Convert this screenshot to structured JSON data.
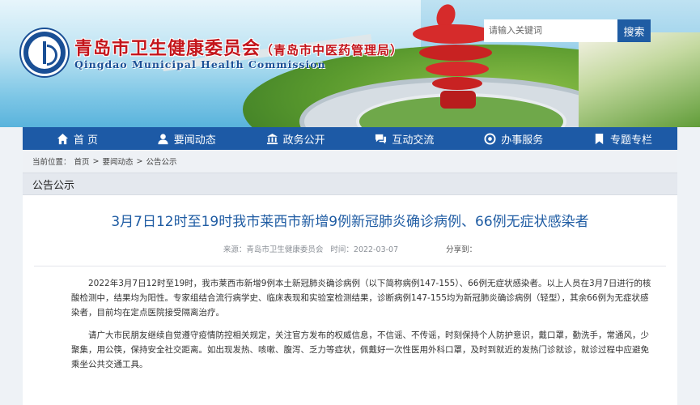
{
  "header": {
    "title_main": "青岛市卫生健康委员会",
    "title_sub": "（青岛市中医药管理局）",
    "title_en": "Qingdao Municipal Health Commission",
    "logo_icon": "health-commission-emblem"
  },
  "search": {
    "placeholder": "请输入关键词",
    "button_label": "搜索"
  },
  "nav": {
    "items": [
      {
        "label": "首 页",
        "icon": "home-icon"
      },
      {
        "label": "要闻动态",
        "icon": "user-icon"
      },
      {
        "label": "政务公开",
        "icon": "bank-icon"
      },
      {
        "label": "互动交流",
        "icon": "chat-icon"
      },
      {
        "label": "办事服务",
        "icon": "service-icon"
      },
      {
        "label": "专题专栏",
        "icon": "bookmark-icon"
      }
    ]
  },
  "breadcrumb": {
    "prefix": "当前位置：",
    "items": [
      "首页",
      "要闻动态",
      "公告公示"
    ],
    "separator": ">"
  },
  "section": {
    "title": "公告公示"
  },
  "article": {
    "title": "3月7日12时至19时我市莱西市新增9例新冠肺炎确诊病例、66例无症状感染者",
    "source_label": "来源：",
    "source": "青岛市卫生健康委员会",
    "time_label": "时间：",
    "time": "2022-03-07",
    "share_label": "分享到：",
    "paragraphs": [
      "2022年3月7日12时至19时，我市莱西市新增9例本土新冠肺炎确诊病例（以下简称病例147-155）、66例无症状感染者。以上人员在3月7日进行的核酸检测中，结果均为阳性。专家组结合流行病学史、临床表现和实验室检测结果，诊断病例147-155均为新冠肺炎确诊病例（轻型），其余66例为无症状感染者，目前均在定点医院接受隔离治疗。",
      "请广大市民朋友继续自觉遵守疫情防控相关规定，关注官方发布的权威信息，不信谣、不传谣，时刻保持个人防护意识，戴口罩，勤洗手，常通风，少聚集，用公筷，保持安全社交距离。如出现发热、咳嗽、腹泻、乏力等症状，佩戴好一次性医用外科口罩，及时到就近的发热门诊就诊，就诊过程中应避免乘坐公共交通工具。"
    ]
  },
  "colors": {
    "primary_blue": "#1d5aa6",
    "title_red": "#c4161c",
    "article_title_blue": "#1f5ca3"
  }
}
